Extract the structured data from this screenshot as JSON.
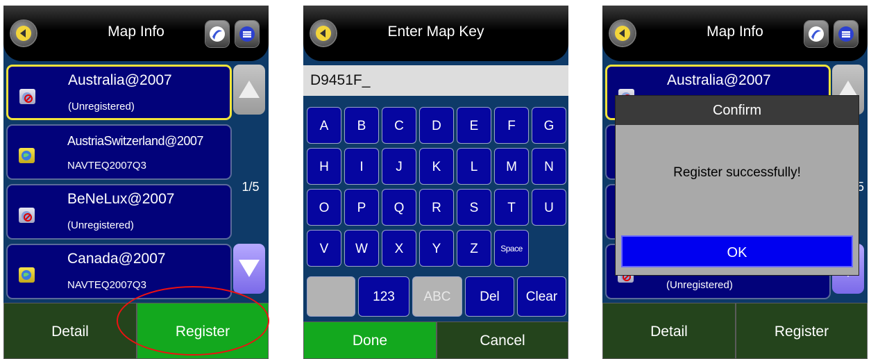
{
  "screen1": {
    "title": "Map Info",
    "page_indicator": "1/5",
    "items": [
      {
        "name": "Australia@2007",
        "status": "(Unregistered)",
        "icon": "unregistered-map-icon"
      },
      {
        "name": "AustriaSwitzerland@2007",
        "status": "NAVTEQ2007Q3",
        "icon": "globe-map-icon"
      },
      {
        "name": "BeNeLux@2007",
        "status": "(Unregistered)",
        "icon": "unregistered-map-icon"
      },
      {
        "name": "Canada@2007",
        "status": "NAVTEQ2007Q3",
        "icon": "globe-map-icon"
      }
    ],
    "detail_label": "Detail",
    "register_label": "Register"
  },
  "screen2": {
    "title": "Enter Map Key",
    "input_value": "D9451F_",
    "keys_row1": [
      "A",
      "B",
      "C",
      "D",
      "E",
      "F",
      "G"
    ],
    "keys_row2": [
      "H",
      "I",
      "J",
      "K",
      "L",
      "M",
      "N"
    ],
    "keys_row3": [
      "O",
      "P",
      "Q",
      "R",
      "S",
      "T",
      "U"
    ],
    "keys_row4": [
      "V",
      "W",
      "X",
      "Y",
      "Z",
      "Space"
    ],
    "key_123": "123",
    "key_abc": "ABC",
    "key_del": "Del",
    "key_clear": "Clear",
    "done_label": "Done",
    "cancel_label": "Cancel"
  },
  "screen3": {
    "title": "Map Info",
    "item_top_name": "Australia@2007",
    "item_bottom_status": "(Unregistered)",
    "page_digit": "5",
    "dialog_title": "Confirm",
    "dialog_message": "Register successfully!",
    "ok_label": "OK",
    "detail_label": "Detail",
    "register_label": "Register"
  },
  "colors": {
    "screen_bg": "#0e3a68",
    "item_bg": "#02027a",
    "selected_border": "#f2e33b",
    "button_green": "#13a81e",
    "button_dark": "#24441c",
    "key_bg": "#0606a0",
    "annotation_circle": "#e11111"
  }
}
